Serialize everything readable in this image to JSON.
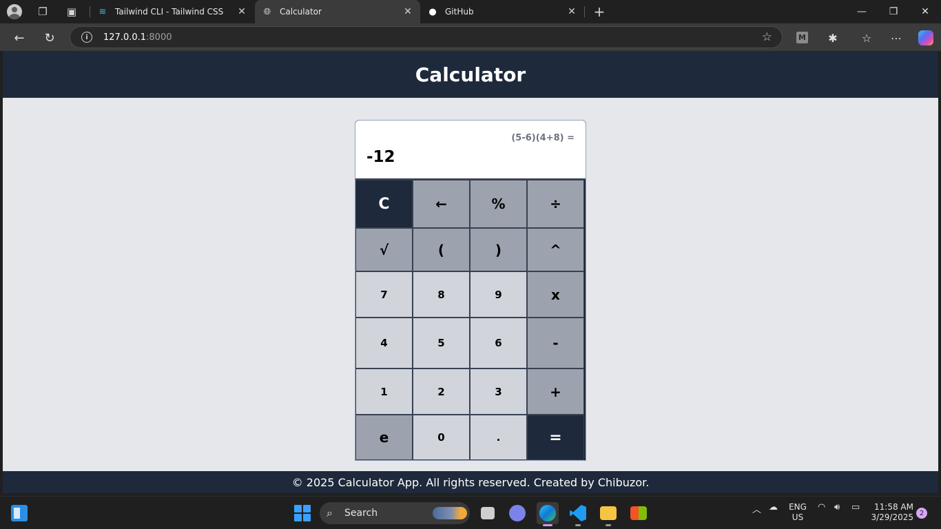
{
  "browser": {
    "tabs": [
      {
        "title": "Tailwind CLI - Tailwind CSS",
        "favicon": "tailwind-icon",
        "active": false
      },
      {
        "title": "Calculator",
        "favicon": "globe-icon",
        "active": true
      },
      {
        "title": "GitHub",
        "favicon": "github-icon",
        "active": false
      }
    ],
    "address": {
      "host": "127.0.0.1",
      "port": ":8000"
    }
  },
  "page": {
    "header_title": "Calculator",
    "display": {
      "expression": "(5-6)(4+8) =",
      "result": "-12"
    },
    "keys": [
      {
        "label": "C",
        "kind": "dark"
      },
      {
        "label": "←",
        "kind": "op"
      },
      {
        "label": "%",
        "kind": "op"
      },
      {
        "label": "÷",
        "kind": "op"
      },
      {
        "label": "√",
        "kind": "op"
      },
      {
        "label": "(",
        "kind": "op"
      },
      {
        "label": ")",
        "kind": "op"
      },
      {
        "label": "^",
        "kind": "op"
      },
      {
        "label": "7",
        "kind": "num"
      },
      {
        "label": "8",
        "kind": "num"
      },
      {
        "label": "9",
        "kind": "num"
      },
      {
        "label": "x",
        "kind": "op"
      },
      {
        "label": "4",
        "kind": "num"
      },
      {
        "label": "5",
        "kind": "num"
      },
      {
        "label": "6",
        "kind": "num"
      },
      {
        "label": "-",
        "kind": "op"
      },
      {
        "label": "1",
        "kind": "num"
      },
      {
        "label": "2",
        "kind": "num"
      },
      {
        "label": "3",
        "kind": "num"
      },
      {
        "label": "+",
        "kind": "op"
      },
      {
        "label": "e",
        "kind": "op"
      },
      {
        "label": "0",
        "kind": "num"
      },
      {
        "label": ".",
        "kind": "num"
      },
      {
        "label": "=",
        "kind": "dark"
      }
    ],
    "footer": "© 2025 Calculator App. All rights reserved. Created by Chibuzor."
  },
  "colors": {
    "header_bg": "#1e293b",
    "page_bg": "#e5e7eb",
    "key_num": "#d1d5db",
    "key_op": "#9ca3af",
    "key_dark": "#1e293b"
  },
  "taskbar": {
    "search_label": "Search",
    "lang_top": "ENG",
    "lang_bottom": "US",
    "time": "11:58 AM",
    "date": "3/29/2025",
    "notification_count": "2"
  }
}
